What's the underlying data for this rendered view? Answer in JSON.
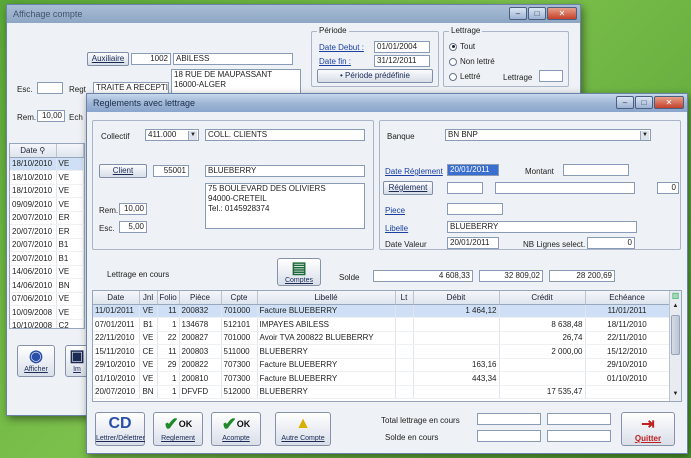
{
  "back_window": {
    "title": "Affichage compte",
    "auxiliaire_button": "Auxiliaire",
    "aux_code": "1002",
    "aux_name": "ABILESS",
    "esc_label": "Esc.",
    "regl_label": "Regt",
    "regl_value": "TRAITE A RECEPTION",
    "address_lines": [
      "18 RUE DE MAUPASSANT",
      "16000-ALGER"
    ],
    "rem_label": "Rem.",
    "rem_value": "10,00",
    "ech_label": "Ech",
    "periode": {
      "title": "Période",
      "date_debut_label": "Date Debut :",
      "date_debut": "01/01/2004",
      "date_fin_label": "Date fin :",
      "date_fin": "31/12/2011",
      "predefined_button": "Période prédéfinie"
    },
    "lettrage": {
      "title": "Lettrage",
      "options": [
        "Tout",
        "Non lettré",
        "Lettré"
      ],
      "selected": "Tout",
      "lettrage_label": "Lettrage"
    },
    "list_header_date": "Date",
    "list_rows": [
      {
        "date": "18/10/2010",
        "j": "VE"
      },
      {
        "date": "18/10/2010",
        "j": "VE"
      },
      {
        "date": "18/10/2010",
        "j": "VE"
      },
      {
        "date": "09/09/2010",
        "j": "VE"
      },
      {
        "date": "20/07/2010",
        "j": "ER"
      },
      {
        "date": "20/07/2010",
        "j": "ER"
      },
      {
        "date": "20/07/2010",
        "j": "B1"
      },
      {
        "date": "20/07/2010",
        "j": "B1"
      },
      {
        "date": "14/06/2010",
        "j": "VE"
      },
      {
        "date": "14/06/2010",
        "j": "BN"
      },
      {
        "date": "07/06/2010",
        "j": "VE"
      },
      {
        "date": "10/09/2008",
        "j": "VE"
      },
      {
        "date": "10/10/2008",
        "j": "C2"
      }
    ],
    "afficher_button": "Afficher",
    "partial_button": "Im"
  },
  "front_window": {
    "title": "Reglements avec lettrage",
    "collectif_label": "Collectif",
    "collectif_value": "411.000",
    "collectif_name": "COLL. CLIENTS",
    "client_button": "Client",
    "client_code": "55001",
    "client_name": "BLUEBERRY",
    "address_lines": [
      "75 BOULEVARD DES OLIVIERS",
      "94000-CRETEIL",
      "Tel.: 0145928374"
    ],
    "rem_label": "Rem.",
    "rem_value": "10,00",
    "esc_label": "Esc.",
    "esc_value": "5,00",
    "banque_label": "Banque",
    "banque_value": "BN  BNP",
    "date_reglement_label": "Date Réglement",
    "date_reglement_value": "20/01/2011",
    "montant_label": "Montant",
    "reglement_button": "Réglement",
    "reglement_side_value": "0",
    "piece_label": "Piece",
    "libelle_label": "Libelle",
    "libelle_value": "BLUEBERRY",
    "date_valeur_label": "Date Valeur",
    "date_valeur_value": "20/01/2011",
    "nb_lignes_label": "NB Lignes select.",
    "nb_lignes_value": "0",
    "lettrage_en_cours_label": "Lettrage en cours",
    "comptes_button": "Comptes",
    "solde_label": "Solde",
    "solde_value": "4 608,33",
    "total_debit": "32 809,02",
    "total_credit": "28 200,69",
    "columns": [
      "Date",
      "Jnl",
      "Folio",
      "Pièce",
      "Cpte",
      "Libellé",
      "Lt",
      "Débit",
      "Crédit",
      "Echéance"
    ],
    "rows": [
      {
        "date": "11/01/2011",
        "jnl": "VE",
        "folio": "11",
        "piece": "200832",
        "cpte": "701000",
        "libelle": "Facture BLUEBERRY",
        "lt": "",
        "debit": "1 464,12",
        "credit": "",
        "echeance": "11/01/2011"
      },
      {
        "date": "07/01/2011",
        "jnl": "B1",
        "folio": "1",
        "piece": "134678",
        "cpte": "512101",
        "libelle": "IMPAYES ABILESS",
        "lt": "",
        "debit": "",
        "credit": "8 638,48",
        "echeance": "18/11/2010"
      },
      {
        "date": "22/11/2010",
        "jnl": "VE",
        "folio": "22",
        "piece": "200827",
        "cpte": "701000",
        "libelle": "Avoir TVA 200822 BLUEBERRY",
        "lt": "",
        "debit": "",
        "credit": "26,74",
        "echeance": "22/11/2010"
      },
      {
        "date": "15/11/2010",
        "jnl": "CE",
        "folio": "11",
        "piece": "200803",
        "cpte": "511000",
        "libelle": "BLUEBERRY",
        "lt": "",
        "debit": "",
        "credit": "2 000,00",
        "echeance": "15/12/2010"
      },
      {
        "date": "29/10/2010",
        "jnl": "VE",
        "folio": "29",
        "piece": "200822",
        "cpte": "707300",
        "libelle": "Facture BLUEBERRY",
        "lt": "",
        "debit": "163,16",
        "credit": "",
        "echeance": "29/10/2010"
      },
      {
        "date": "01/10/2010",
        "jnl": "VE",
        "folio": "1",
        "piece": "200810",
        "cpte": "707300",
        "libelle": "Facture BLUEBERRY",
        "lt": "",
        "debit": "443,34",
        "credit": "",
        "echeance": "01/10/2010"
      },
      {
        "date": "20/07/2010",
        "jnl": "BN",
        "folio": "1",
        "piece": "DFVFD",
        "cpte": "512000",
        "libelle": "BLUEBERRY",
        "lt": "",
        "debit": "",
        "credit": "17 535,47",
        "echeance": ""
      }
    ],
    "toolbar": {
      "lettrer_label": "Lettrer/Délettrer",
      "reglement_label": "Reglement",
      "acompte_label": "Acompte",
      "autre_compte_label": "Autre Compte",
      "ok_label": "OK",
      "quitter_label": "Quitter"
    },
    "total_lettrage_label": "Total lettrage en cours",
    "solde_en_cours_label": "Solde en cours"
  },
  "colors": {
    "background": "#5aa838",
    "titlebar": "#9fb6d6",
    "highlight_row": "#cfe0f6",
    "accent_link": "#1a3fa0"
  }
}
